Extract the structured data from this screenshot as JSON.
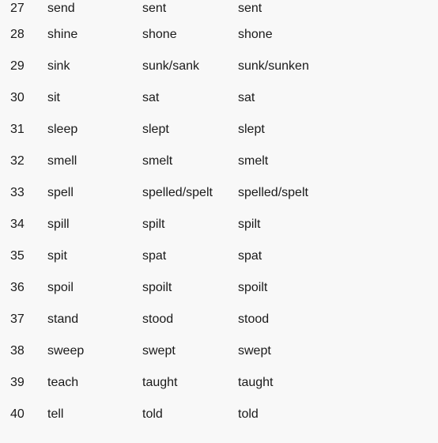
{
  "verbs": [
    {
      "num": "27",
      "base": "send",
      "past": "sent",
      "participle": "sent"
    },
    {
      "num": "28",
      "base": "shine",
      "past": "shone",
      "participle": "shone"
    },
    {
      "num": "29",
      "base": "sink",
      "past": "sunk/sank",
      "participle": "sunk/sunken"
    },
    {
      "num": "30",
      "base": "sit",
      "past": "sat",
      "participle": "sat"
    },
    {
      "num": "31",
      "base": "sleep",
      "past": "slept",
      "participle": "slept"
    },
    {
      "num": "32",
      "base": "smell",
      "past": "smelt",
      "participle": "smelt"
    },
    {
      "num": "33",
      "base": "spell",
      "past": "spelled/spelt",
      "participle": "spelled/spelt"
    },
    {
      "num": "34",
      "base": "spill",
      "past": "spilt",
      "participle": "spilt"
    },
    {
      "num": "35",
      "base": "spit",
      "past": "spat",
      "participle": "spat"
    },
    {
      "num": "36",
      "base": "spoil",
      "past": "spoilt",
      "participle": "spoilt"
    },
    {
      "num": "37",
      "base": "stand",
      "past": "stood",
      "participle": "stood"
    },
    {
      "num": "38",
      "base": "sweep",
      "past": "swept",
      "participle": "swept"
    },
    {
      "num": "39",
      "base": "teach",
      "past": "taught",
      "participle": "taught"
    },
    {
      "num": "40",
      "base": "tell",
      "past": "told",
      "participle": "told"
    }
  ]
}
